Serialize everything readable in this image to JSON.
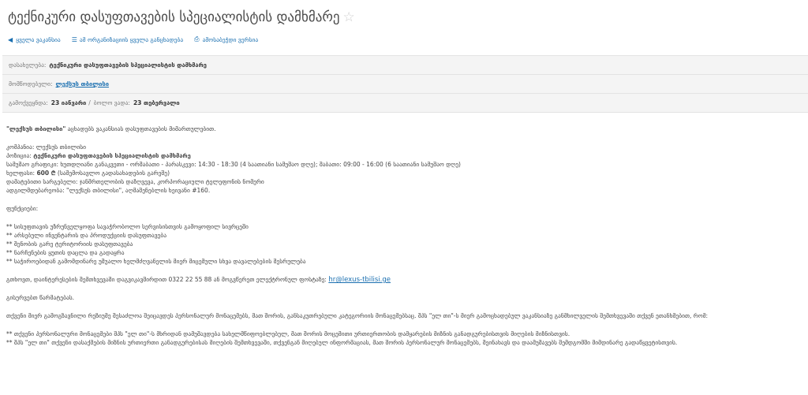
{
  "title": "ტექნიკური დასუფთავების სპეციალისტის დამხმარე",
  "star": "☆",
  "links": {
    "all_jobs": "ყველა ვაკანსია",
    "org_jobs": "ამ ორგანიზაციის ყველა განცხადება",
    "print": "ამოსაბეჭდი ვერსია"
  },
  "meta": {
    "position_label": "დასახელება:",
    "position": "ტექნიკური დასუფთავების სპეციალისტის დამხმარე",
    "employer_label": "მომწოდებელი:",
    "employer": "ლექსუს თბილისი",
    "dates_label": "გამოქვეყნდა:",
    "published": "23 იანვარი",
    "sep": "/",
    "deadline_label": "ბოლო ვადა:",
    "deadline": "23 თებერვალი"
  },
  "body": {
    "intro_company": "\"ლექსუს თბილისი\"",
    "intro_rest": "აცხადებს ვაკანსიას დასუფთავების მიმართულებით.",
    "company_label": "კომპანია:",
    "company": "ლექსუს თბილისი",
    "position_label": "პოზიცია:",
    "position": "ტექნიკური დასუფთავების სპეციალისტის დამხმარე",
    "schedule_label": "სამუშაო გრაფიკი:",
    "schedule_a": "ხუთდღიანი განაკვეთი - ორშაბათი - პარასკევი:",
    "schedule_a_hours": "14:30 - 18:30",
    "schedule_a_note": "(4 საათიანი სამუშაო დღე); შაბათი:",
    "schedule_b_hours": "09:00 - 16:00",
    "schedule_b_note": "(6 საათიანი სამუშაო დღე)",
    "salary_label": "ხელფასი:",
    "salary": "600 ₾",
    "salary_note": "(საშემოსავლო გადასახადების გარეშე)",
    "extra_label": "დამატებითი სარგებელი:",
    "extra": "ჯანმრთელობის დაზღვევა, კორპორაციული ტელეფონის ნომერი",
    "address_label": "ადგილმდებარეობა:",
    "address": "\"ლექსუს თბილისი\", აღმაშენებლის ხეივანი",
    "address_num": "#160.",
    "duties_label": "ფუნქციები:",
    "duties": [
      "** სისუფთავის უზრუნველყოფა სავაჭრობოლო სერვისისთვის გამოყოფილ სივრცეში",
      "** არსებული ინვენტარის და პროდუქციის დასუფთავება",
      "** შენობის გარე ტერიტორიის დასუფთავება",
      "** ნარჩენების ყუთის დაცლა და გადაყრა",
      "** საჭიროებიდან გამომდინარე უშუალო ხელმძღვანელის მიერ მიცემული სხვა დავალებების შესრულება"
    ],
    "contact_text": "გთხოვთ, დაინტერესების შემთხვევაში დაგვიკავშირდით 0322 22 55 88 ან მოგვწერეთ ელექტრონულ ფოსტაზე:",
    "email": "hr@lexus-tbilisi.ge",
    "thanks": "გისურვებთ წარმატებას.",
    "policy": "თქვენი მიერ გამოგზავნილი რეზიუმე შესაძლოა შეიცავდეს პერსონალურ მონაცემებს, მათ შორის, განსაკუთრებული კატეგორიის მონაცემებსაც. შპს \"ელ თი\"-ს მიერ გამოცხადებულ ვაკანსიაზე განმხილველის შემთხვევაში თქვენ ეთანხმებით, რომ:",
    "policy_items": [
      "** თქვენი პერსონალური მონაცემები შპს \"ელ თი\"-ს მხრიდან დამუშავდება სახელმწიფოებლებულ, მათ შორის მოცემითი ურთიერთობის დამყარების მიზნის განადგურებისთვის მიღების მიზნისთვის.",
      "** შპს \"ელ თი\" თქვენი დასაქმების მიზნის ურთიერთი განადგურებისას მიღების შემთხვევაში, თქვენგან მიღებულ ინფორმაციას, მათ შორის პერსონალურ მონაცემებს, შეინახავს და დაამუშავებს შემდგომში მიმდინარე გადაწყვეტისთვის."
    ]
  }
}
